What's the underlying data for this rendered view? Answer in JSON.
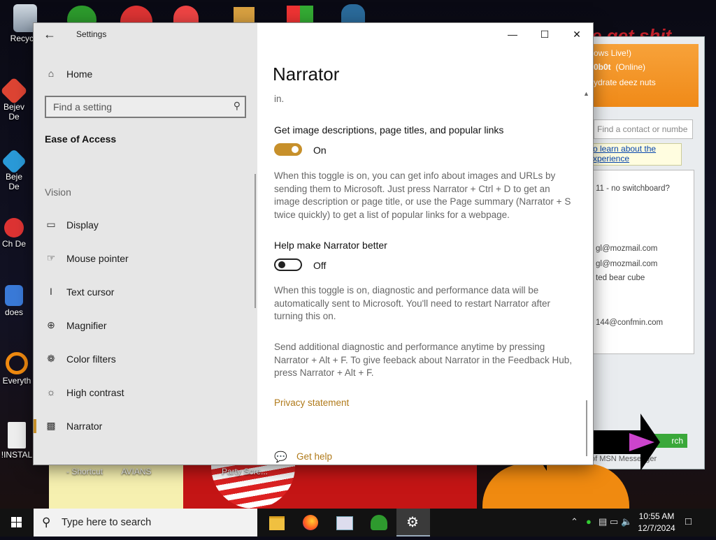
{
  "desktop": {
    "icons": [
      {
        "label": "Recycle"
      },
      {
        "label": "Bejev De"
      },
      {
        "label": "Beje De"
      },
      {
        "label": "Ch De"
      },
      {
        "label": "does"
      },
      {
        "label": "Everyth"
      },
      {
        "label": "!INSTAL"
      },
      {
        "label": "- Shortcut"
      },
      {
        "label": "AVIANS"
      },
      {
        "label": "Party Scre..."
      }
    ],
    "bg_text": "e get shit"
  },
  "msn": {
    "user": "ows Live!)",
    "status_name": "0b0t",
    "status": "(Online)",
    "personal_msg": "ydrate deez nuts",
    "find_placeholder": "Find a contact or numbe",
    "news_line1": "o learn about the",
    "news_line2": "xperience",
    "item1": "11 - no switchboard?",
    "contacts": [
      "gl@mozmail.com",
      "gl@mozmail.com",
      "ted bear cube",
      "144@confmin.com"
    ],
    "search_btn": "rch",
    "footer": "of MSN Messenger"
  },
  "settings": {
    "window_title": "Settings",
    "home_label": "Home",
    "search_placeholder": "Find a setting",
    "section_title": "Ease of Access",
    "group_label": "Vision",
    "nav_items": [
      {
        "label": "Display",
        "icon": "monitor-icon"
      },
      {
        "label": "Mouse pointer",
        "icon": "mouse-pointer-icon"
      },
      {
        "label": "Text cursor",
        "icon": "text-cursor-icon"
      },
      {
        "label": "Magnifier",
        "icon": "magnifier-icon"
      },
      {
        "label": "Color filters",
        "icon": "color-filters-icon"
      },
      {
        "label": "High contrast",
        "icon": "high-contrast-icon"
      },
      {
        "label": "Narrator",
        "icon": "narrator-icon"
      }
    ],
    "active_item": "Narrator",
    "accent": "#c7902b",
    "page_title": "Narrator",
    "clipped_text": "in.",
    "opt1_heading": "Get image descriptions, page titles, and popular links",
    "opt1_state": "On",
    "opt1_desc": "When this toggle is on, you can get info about images and URLs by sending them to Microsoft. Just press Narrator + Ctrl + D to get an image description or page title, or use the Page summary (Narrator + S twice quickly) to get a list of popular links for a webpage.",
    "opt2_heading": "Help make Narrator better",
    "opt2_state": "Off",
    "opt2_desc": "When this toggle is on, diagnostic and performance data will be automatically sent to Microsoft. You'll need to restart Narrator after turning this on.",
    "extra_desc": "Send additional diagnostic and performance anytime by pressing Narrator + Alt + F. To give feeback about Narrator in the Feedback Hub, press Narrator + Alt + F.",
    "privacy_link": "Privacy statement",
    "get_help": "Get help"
  },
  "taskbar": {
    "search_placeholder": "Type here to search",
    "time": "10:55 AM",
    "date": "12/7/2024"
  }
}
